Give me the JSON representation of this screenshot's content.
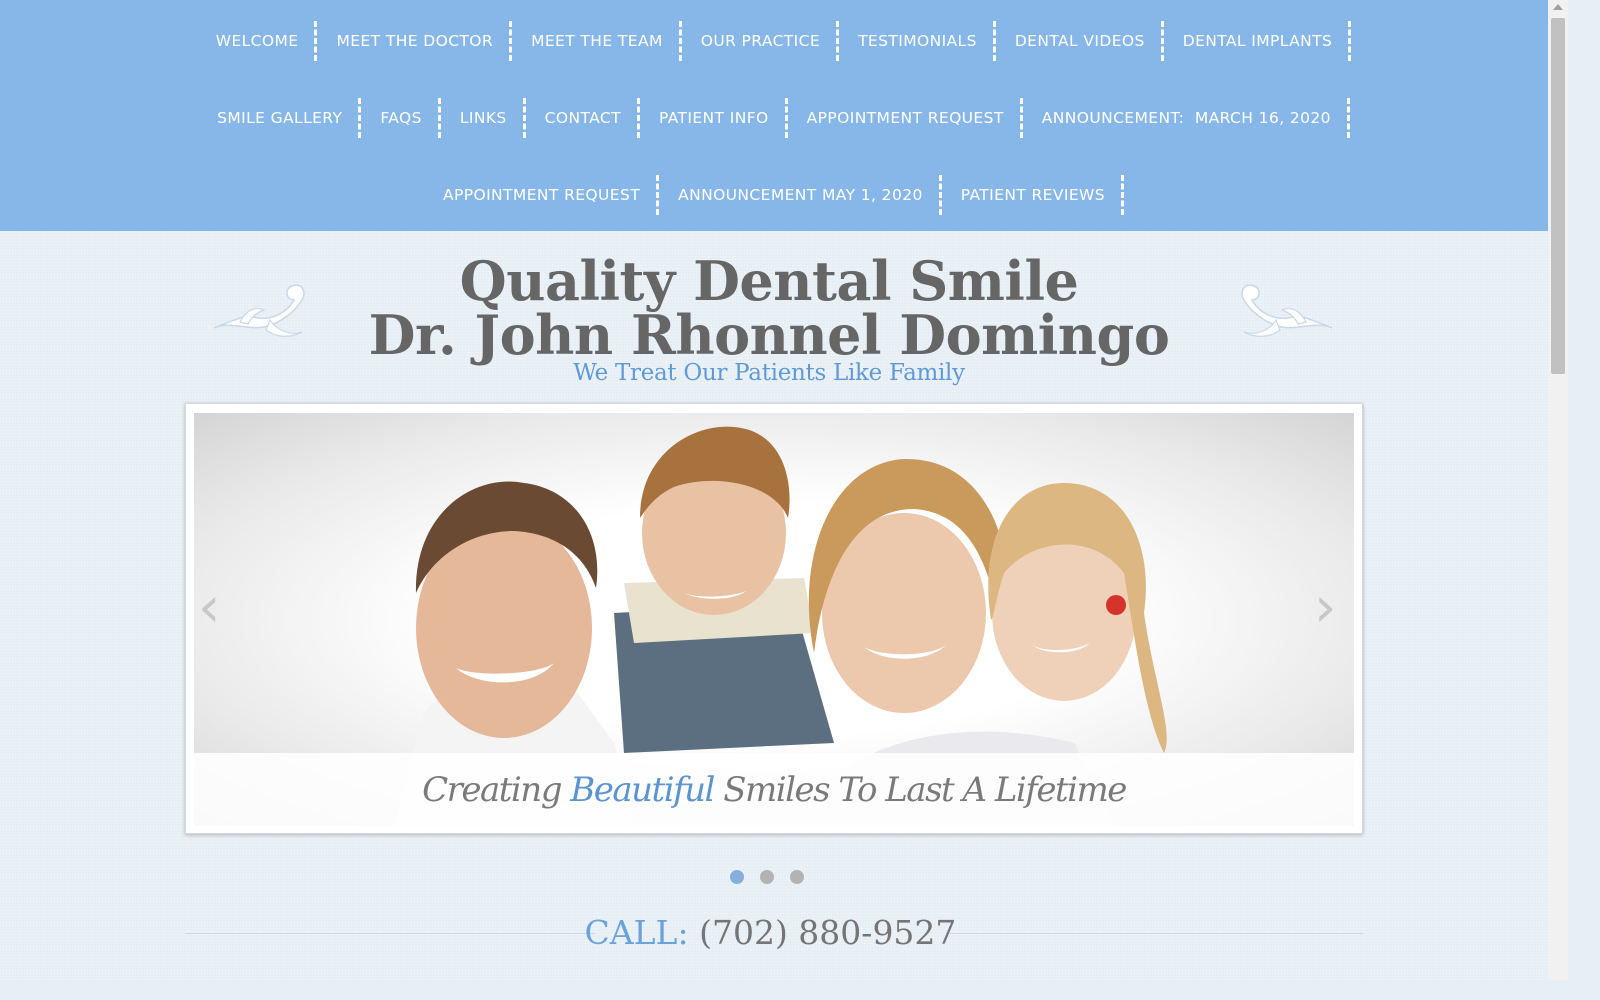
{
  "nav": {
    "row1": [
      "WELCOME",
      "MEET THE DOCTOR",
      "MEET THE TEAM",
      "OUR PRACTICE",
      "TESTIMONIALS",
      "DENTAL VIDEOS",
      "DENTAL IMPLANTS"
    ],
    "row2": [
      "SMILE GALLERY",
      "FAQS",
      "LINKS",
      "CONTACT",
      "PATIENT INFO",
      "APPOINTMENT REQUEST",
      "ANNOUNCEMENT:  MARCH 16, 2020"
    ],
    "row3": [
      "APPOINTMENT REQUEST",
      "ANNOUNCEMENT MAY 1, 2020",
      "PATIENT REVIEWS"
    ]
  },
  "header": {
    "title_line1": "Quality Dental Smile",
    "title_line2": "Dr. John Rhonnel Domingo",
    "tagline": "We Treat Our Patients Like Family"
  },
  "slider": {
    "caption_before": "Creating ",
    "caption_highlight": "Beautiful",
    "caption_after": " Smiles To Last A Lifetime",
    "prev_symbol": "‹",
    "next_symbol": "›",
    "slide_count": 3,
    "active_slide": 1
  },
  "contact": {
    "call_label": "CALL:",
    "phone": "(702) 880-9527"
  },
  "colors": {
    "nav_bg": "#87b7e9",
    "accent_blue": "#5f9ad6",
    "title_gray": "#666666"
  }
}
